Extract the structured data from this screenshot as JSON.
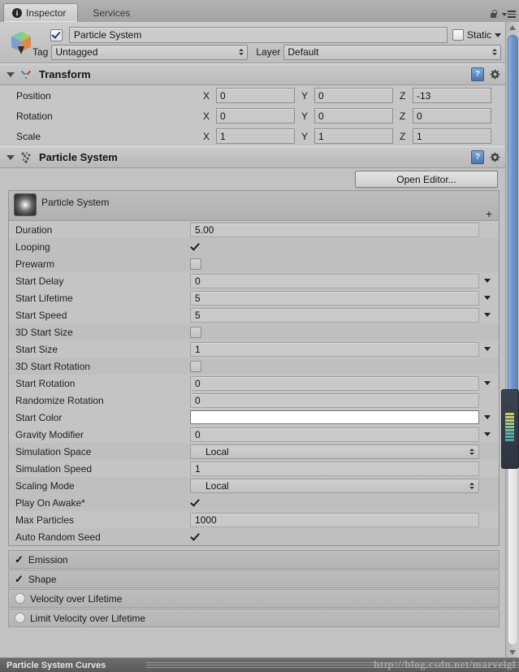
{
  "window": {
    "tabs": [
      {
        "label": "Inspector",
        "icon": "info-icon",
        "active": true
      },
      {
        "label": "Services",
        "icon": "",
        "active": false
      }
    ],
    "lock_icon": "lock-icon",
    "menu_icon": "hamburger-menu-icon"
  },
  "object_header": {
    "icon": "prefab-cube-icon",
    "enabled": true,
    "name": "Particle System",
    "static_label": "Static",
    "static_checked": false,
    "tag_label": "Tag",
    "tag_value": "Untagged",
    "layer_label": "Layer",
    "layer_value": "Default"
  },
  "transform": {
    "title": "Transform",
    "icon": "transform-gizmo-icon",
    "help_icon": "help-icon",
    "gear_icon": "gear-icon",
    "rows": [
      {
        "label": "Position",
        "x": "0",
        "y": "0",
        "z": "-13"
      },
      {
        "label": "Rotation",
        "x": "0",
        "y": "0",
        "z": "0"
      },
      {
        "label": "Scale",
        "x": "1",
        "y": "1",
        "z": "1"
      }
    ],
    "axis_labels": [
      "X",
      "Y",
      "Z"
    ]
  },
  "particle_system": {
    "title": "Particle System",
    "icon": "particle-system-icon",
    "help_icon": "help-icon",
    "gear_icon": "gear-icon",
    "open_editor_label": "Open Editor...",
    "module_title": "Particle System",
    "module_icon": "particle-glow-icon",
    "plus_label": "+",
    "properties": [
      {
        "label": "Duration",
        "type": "text",
        "value": "5.00",
        "dropdown": false
      },
      {
        "label": "Looping",
        "type": "checkbox",
        "value": true,
        "dropdown": false
      },
      {
        "label": "Prewarm",
        "type": "checkbox",
        "value": false,
        "dropdown": false
      },
      {
        "label": "Start Delay",
        "type": "text",
        "value": "0",
        "dropdown": true
      },
      {
        "label": "Start Lifetime",
        "type": "text",
        "value": "5",
        "dropdown": true
      },
      {
        "label": "Start Speed",
        "type": "text",
        "value": "5",
        "dropdown": true
      },
      {
        "label": "3D Start Size",
        "type": "checkbox",
        "value": false,
        "dropdown": false
      },
      {
        "label": "Start Size",
        "type": "text",
        "value": "1",
        "dropdown": true
      },
      {
        "label": "3D Start Rotation",
        "type": "checkbox",
        "value": false,
        "dropdown": false
      },
      {
        "label": "Start Rotation",
        "type": "text",
        "value": "0",
        "dropdown": true
      },
      {
        "label": "Randomize Rotation",
        "type": "text",
        "value": "0",
        "dropdown": false
      },
      {
        "label": "Start Color",
        "type": "color",
        "value": "#ffffff",
        "dropdown": true
      },
      {
        "label": "Gravity Modifier",
        "type": "text",
        "value": "0",
        "dropdown": true
      },
      {
        "label": "Simulation Space",
        "type": "select",
        "value": "Local",
        "dropdown": false
      },
      {
        "label": "Simulation Speed",
        "type": "text",
        "value": "1",
        "dropdown": false
      },
      {
        "label": "Scaling Mode",
        "type": "select",
        "value": "Local",
        "dropdown": false
      },
      {
        "label": "Play On Awake*",
        "type": "checkbox",
        "value": true,
        "dropdown": false
      },
      {
        "label": "Max Particles",
        "type": "text",
        "value": "1000",
        "dropdown": false
      },
      {
        "label": "Auto Random Seed",
        "type": "checkbox",
        "value": true,
        "dropdown": false
      }
    ],
    "modules": [
      {
        "label": "Emission",
        "toggle": "check"
      },
      {
        "label": "Shape",
        "toggle": "check"
      },
      {
        "label": "Velocity over Lifetime",
        "toggle": "circle"
      },
      {
        "label": "Limit Velocity over Lifetime",
        "toggle": "circle"
      }
    ]
  },
  "status_bar": {
    "label": "Particle System Curves",
    "watermark": "http://blog.csdn.net/marvelgl"
  },
  "colors": {
    "panel_bg": "#c2c2c2",
    "header_bg": "#cacaca",
    "scroll_thumb": "#6d94c6",
    "status_bg": "#5f5f5f",
    "help_blue": "#4a74ac"
  }
}
